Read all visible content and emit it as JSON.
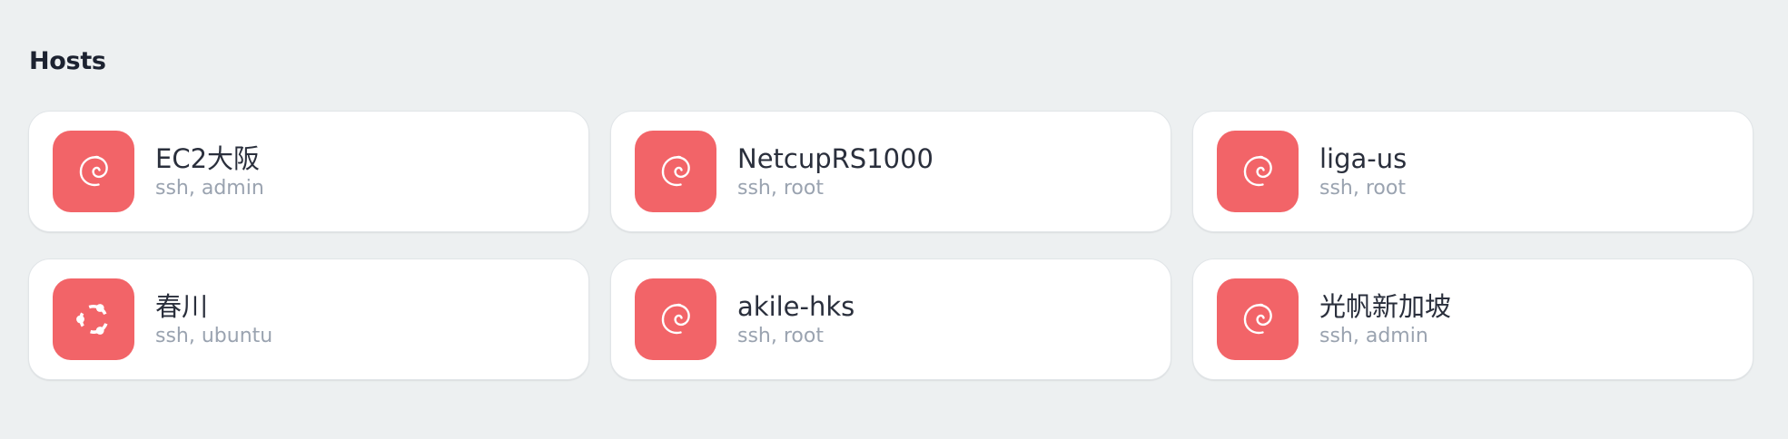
{
  "section": {
    "title": "Hosts"
  },
  "colors": {
    "background": "#edf0f1",
    "card": "#ffffff",
    "icon_bg": "#f26468",
    "title_text": "#1c2230",
    "name_text": "#2a2f3c",
    "sub_text": "#9aa3b0"
  },
  "hosts": [
    {
      "name": "EC2大阪",
      "subtitle": "ssh, admin",
      "os_icon": "debian-icon"
    },
    {
      "name": "NetcupRS1000",
      "subtitle": "ssh, root",
      "os_icon": "debian-icon"
    },
    {
      "name": "liga-us",
      "subtitle": "ssh, root",
      "os_icon": "debian-icon"
    },
    {
      "name": "春川",
      "subtitle": "ssh, ubuntu",
      "os_icon": "ubuntu-icon"
    },
    {
      "name": "akile-hks",
      "subtitle": "ssh, root",
      "os_icon": "debian-icon"
    },
    {
      "name": "光帆新加坡",
      "subtitle": "ssh, admin",
      "os_icon": "debian-icon"
    }
  ]
}
